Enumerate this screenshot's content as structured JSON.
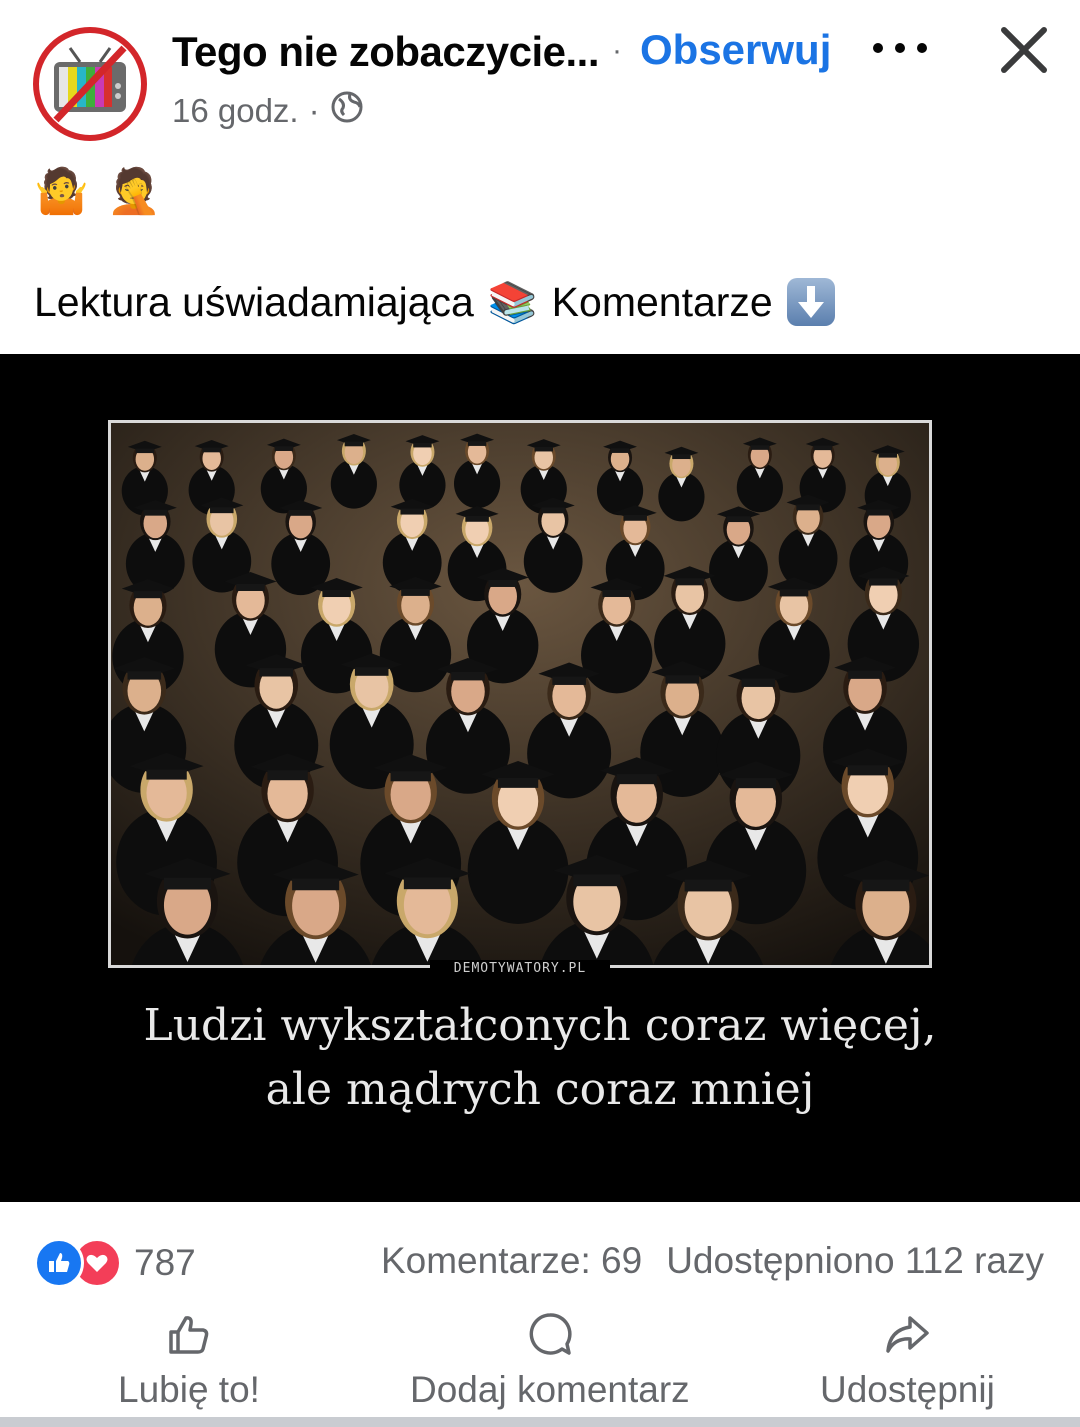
{
  "post": {
    "page_name": "Tego nie zobaczycie...",
    "separator": "·",
    "follow_label": "Obserwuj",
    "time": "16 godz.",
    "meta_separator": "·",
    "privacy_icon": "globe-icon",
    "emoji_line": [
      "🤷",
      "🤦"
    ],
    "text_part1": "Lektura uświadamiająca",
    "text_emoji": "📚",
    "text_part2": "Komentarze",
    "text_arrow_icon": "down-arrow-emoji"
  },
  "media": {
    "watermark": "DEMOTYWATORY.PL",
    "caption_line1": "Ludzi wykształconych coraz więcej,",
    "caption_line2": "ale mądrych coraz mniej"
  },
  "stats": {
    "reaction_icons": [
      "like-icon",
      "love-icon"
    ],
    "reaction_count": "787",
    "comments": "Komentarze: 69",
    "shares": "Udostępniono 112 razy"
  },
  "actions": {
    "like": "Lubię to!",
    "comment": "Dodaj komentarz",
    "share": "Udostępnij"
  },
  "colors": {
    "accent": "#1b74e4",
    "secondary_text": "#65676b",
    "like_blue": "#1877f2",
    "love_red": "#f33e58"
  }
}
